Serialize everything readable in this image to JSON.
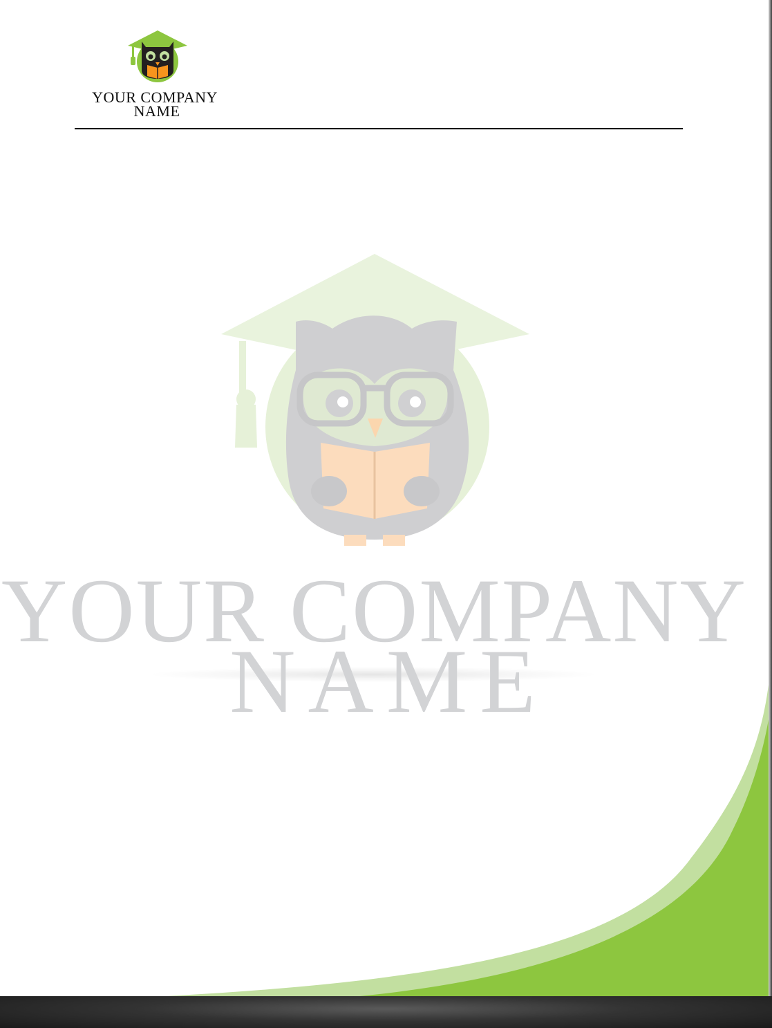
{
  "header": {
    "logo_icon": "graduation-owl-icon",
    "company_line1": "YOUR COMPANY",
    "company_line2": "NAME"
  },
  "watermark": {
    "logo_icon": "graduation-owl-icon",
    "company_line1": "YOUR COMPANY",
    "company_line2": "NAME"
  },
  "colors": {
    "accent_green": "#8dc63f",
    "light_green": "#c2dfa0",
    "watermark_grey": "#d2d3d5",
    "owl_book_orange": "#f7941d",
    "rule": "#111111"
  }
}
